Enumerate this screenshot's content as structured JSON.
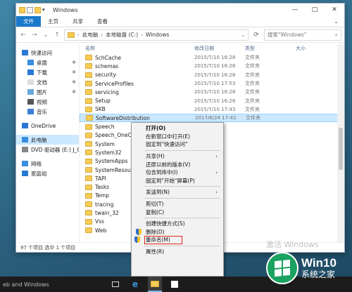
{
  "window": {
    "title": "Windows",
    "controls": [
      "—",
      "□",
      "✕"
    ]
  },
  "ribbon": {
    "tabs": [
      "文件",
      "主页",
      "共享",
      "查看"
    ],
    "expand": "⌄"
  },
  "address": {
    "crumbs": [
      "此电脑",
      "本地磁盘 (C:)",
      "Windows"
    ],
    "search_placeholder": "搜索\"Windows\""
  },
  "nav": {
    "items": [
      {
        "label": "快速访问",
        "icon": "star-icon",
        "sub": false,
        "pin": false
      },
      {
        "label": "桌面",
        "icon": "desktop-icon",
        "sub": true,
        "pin": true
      },
      {
        "label": "下载",
        "icon": "download-icon",
        "sub": true,
        "pin": true
      },
      {
        "label": "文档",
        "icon": "document-icon",
        "sub": true,
        "pin": true
      },
      {
        "label": "图片",
        "icon": "picture-icon",
        "sub": true,
        "pin": true
      },
      {
        "label": "视频",
        "icon": "video-icon",
        "sub": true,
        "pin": false
      },
      {
        "label": "音乐",
        "icon": "music-icon",
        "sub": true,
        "pin": false
      },
      {
        "label": "OneDrive",
        "icon": "cloud-icon",
        "sub": false,
        "pin": false
      },
      {
        "label": "此电脑",
        "icon": "computer-icon",
        "sub": false,
        "pin": false,
        "selected": true
      },
      {
        "label": "DVD 驱动器 (E:) J_C",
        "icon": "dvd-icon",
        "sub": false,
        "pin": false
      },
      {
        "label": "网络",
        "icon": "network-icon",
        "sub": false,
        "pin": false
      },
      {
        "label": "家庭组",
        "icon": "homegroup-icon",
        "sub": false,
        "pin": false
      }
    ]
  },
  "list": {
    "headers": [
      "名称",
      "修改日期",
      "类型",
      "大小"
    ],
    "rows": [
      {
        "name": "SchCache",
        "date": "2015/7/10 16:28",
        "type": "文件夹"
      },
      {
        "name": "schemas",
        "date": "2015/7/10 16:28",
        "type": "文件夹"
      },
      {
        "name": "security",
        "date": "2015/7/10 16:28",
        "type": "文件夹"
      },
      {
        "name": "ServiceProfiles",
        "date": "2015/7/10 17:53",
        "type": "文件夹"
      },
      {
        "name": "servicing",
        "date": "2015/7/10 16:28",
        "type": "文件夹"
      },
      {
        "name": "Setup",
        "date": "2015/7/10 16:28",
        "type": "文件夹"
      },
      {
        "name": "SKB",
        "date": "2015/7/10 17:43",
        "type": "文件夹"
      },
      {
        "name": "SoftwareDistribution",
        "date": "2017/8/24 17:43",
        "type": "文件夹",
        "selected": true
      },
      {
        "name": "Speech",
        "date": "",
        "type": ""
      },
      {
        "name": "Speech_OneCo",
        "date": "",
        "type": ""
      },
      {
        "name": "System",
        "date": "",
        "type": ""
      },
      {
        "name": "System32",
        "date": "",
        "type": ""
      },
      {
        "name": "SystemApps",
        "date": "",
        "type": ""
      },
      {
        "name": "SystemResour",
        "date": "",
        "type": ""
      },
      {
        "name": "TAPI",
        "date": "",
        "type": ""
      },
      {
        "name": "Tasks",
        "date": "",
        "type": ""
      },
      {
        "name": "Temp",
        "date": "",
        "type": ""
      },
      {
        "name": "tracing",
        "date": "",
        "type": ""
      },
      {
        "name": "twain_32",
        "date": "",
        "type": ""
      },
      {
        "name": "Vss",
        "date": "",
        "type": ""
      },
      {
        "name": "Web",
        "date": "",
        "type": ""
      }
    ]
  },
  "status": "97 个项目    选中 1 个项目",
  "context_menu": {
    "items": [
      {
        "label": "打开(O)",
        "bold": true
      },
      {
        "label": "在新窗口中打开(E)"
      },
      {
        "label": "固定到\"快速访问\""
      },
      {
        "sep": true
      },
      {
        "label": "共享(H)",
        "arrow": true
      },
      {
        "label": "还原以前的版本(V)"
      },
      {
        "label": "包含到库中(I)",
        "arrow": true
      },
      {
        "label": "固定到\"开始\"屏幕(P)"
      },
      {
        "sep": true
      },
      {
        "label": "发送到(N)",
        "arrow": true
      },
      {
        "sep": true
      },
      {
        "label": "剪切(T)"
      },
      {
        "label": "复制(C)"
      },
      {
        "sep": true
      },
      {
        "label": "创建快捷方式(S)"
      },
      {
        "label": "删除(D)",
        "shield": true
      },
      {
        "label": "重命名(M)",
        "shield": true,
        "highlight": true
      },
      {
        "sep": true
      },
      {
        "label": "属性(R)"
      }
    ]
  },
  "taskbar": {
    "text": "eb and Windows",
    "icons": [
      "task-view-icon",
      "edge-icon",
      "file-explorer-icon",
      "store-icon"
    ]
  },
  "watermark": "激活 Windows",
  "brand": {
    "title": "Win10",
    "subtitle": "系统之家"
  }
}
